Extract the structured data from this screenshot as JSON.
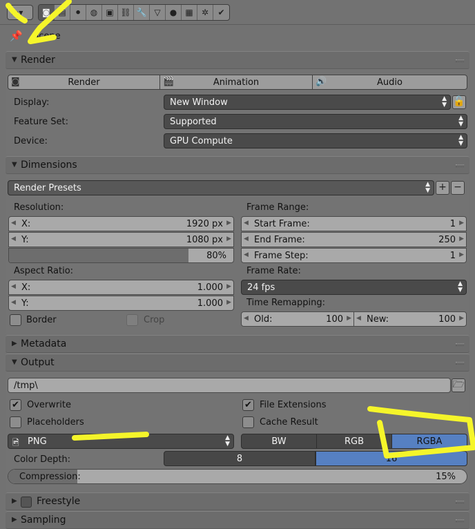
{
  "context": {
    "scene_label": "Scene"
  },
  "tabs": [
    {
      "icon": "render-camera-icon",
      "glyph": "◙",
      "active": true
    },
    {
      "icon": "render-layers-icon",
      "glyph": "▤"
    },
    {
      "icon": "scene-icon",
      "glyph": "⚫"
    },
    {
      "icon": "world-icon",
      "glyph": "◍"
    },
    {
      "icon": "object-icon",
      "glyph": "▣"
    },
    {
      "icon": "constraints-icon",
      "glyph": "⛓"
    },
    {
      "icon": "modifiers-icon",
      "glyph": "🔧"
    },
    {
      "icon": "data-icon",
      "glyph": "▽"
    },
    {
      "icon": "material-icon",
      "glyph": "●"
    },
    {
      "icon": "texture-icon",
      "glyph": "▦"
    },
    {
      "icon": "particles-icon",
      "glyph": "✲"
    },
    {
      "icon": "physics-icon",
      "glyph": "✔"
    }
  ],
  "render": {
    "title": "Render",
    "buttons": {
      "render": "Render",
      "animation": "Animation",
      "audio": "Audio"
    },
    "display_label": "Display:",
    "display_value": "New Window",
    "feature_label": "Feature Set:",
    "feature_value": "Supported",
    "device_label": "Device:",
    "device_value": "GPU Compute"
  },
  "dimensions": {
    "title": "Dimensions",
    "presets": "Render Presets",
    "resolution_label": "Resolution:",
    "res_x_label": "X:",
    "res_x": "1920 px",
    "res_y_label": "Y:",
    "res_y": "1080 px",
    "res_percent": "80%",
    "res_percent_value": 0.8,
    "aspect_label": "Aspect Ratio:",
    "aspect_x_label": "X:",
    "aspect_x": "1.000",
    "aspect_y_label": "Y:",
    "aspect_y": "1.000",
    "border_label": "Border",
    "crop_label": "Crop",
    "frame_range_label": "Frame Range:",
    "start_label": "Start Frame:",
    "start": "1",
    "end_label": "End Frame:",
    "end": "250",
    "step_label": "Frame Step:",
    "step": "1",
    "frame_rate_label": "Frame Rate:",
    "frame_rate": "24 fps",
    "remap_label": "Time Remapping:",
    "old_label": "Old:",
    "old": "100",
    "new_label": "New:",
    "new": "100"
  },
  "metadata": {
    "title": "Metadata"
  },
  "output": {
    "title": "Output",
    "path": "/tmp\\",
    "overwrite": "Overwrite",
    "file_extensions": "File Extensions",
    "placeholders": "Placeholders",
    "cache_result": "Cache Result",
    "format": "PNG",
    "color_modes": [
      "BW",
      "RGB",
      "RGBA"
    ],
    "color_mode_selected": "RGBA",
    "color_depth_label": "Color Depth:",
    "color_depths": [
      "8",
      "16"
    ],
    "color_depth_selected": "16",
    "compression_label": "Compression:",
    "compression": "15%",
    "compression_value": 0.15
  },
  "freestyle": {
    "title": "Freestyle"
  },
  "sampling": {
    "title": "Sampling"
  },
  "colors": {
    "accent": "#5680c2",
    "annotation": "#f5f52a"
  }
}
